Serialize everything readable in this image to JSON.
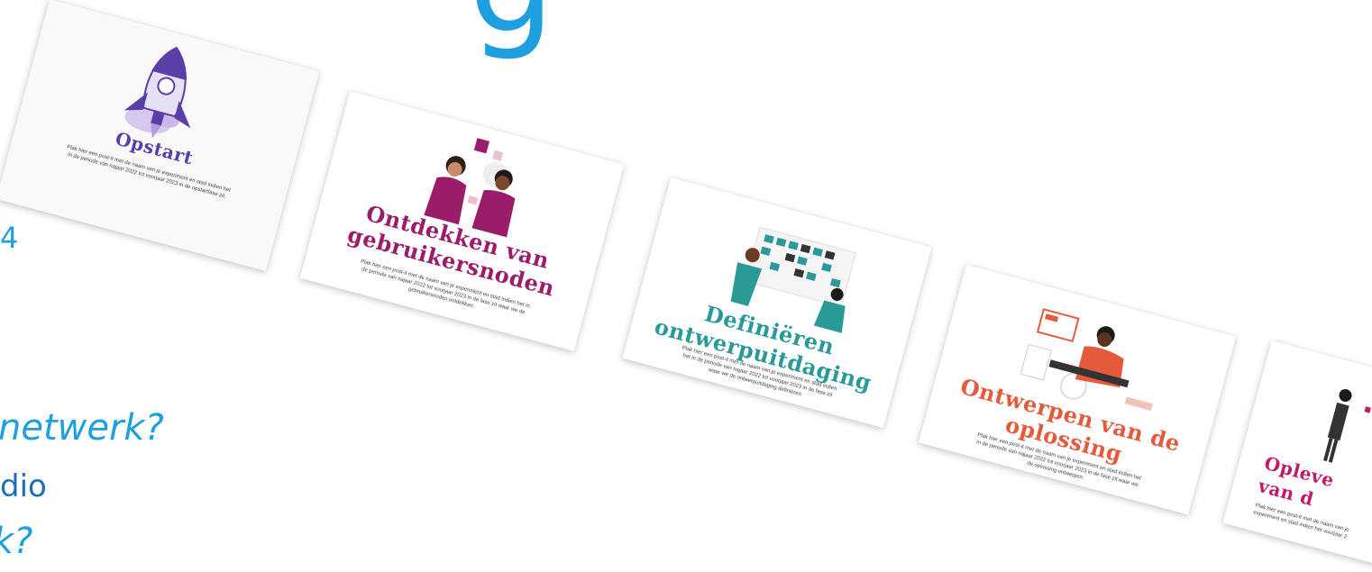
{
  "heading_fragment": "g",
  "left_fragments": {
    "line1": "4",
    "line2": "netwerk?",
    "line3": "dio",
    "line4": "k?"
  },
  "cards": [
    {
      "title": "Opstart",
      "body": "Plak hier een post-it met de naam van je experiment en stad indien het in de periode van najaar 2022 tot voorjaar 2023 in de opstartfase zit.",
      "color": "#5a3fa8",
      "icon": "rocket-icon"
    },
    {
      "title": "Ontdekken van gebruikersnoden",
      "body": "Plak hier een post-it met de naam van je experiment en stad indien het in de periode van najaar 2022 tot voorjaar 2023 in de fase zit waar we de gebruikersnoden ontdekken.",
      "color": "#9b1c6b",
      "icon": "two-people-icon"
    },
    {
      "title": "Definiëren ontwerpuitdaging",
      "body": "Plak hier een post-it met de naam van je experiment en stad indien het in de periode van najaar 2022 tot voorjaar 2023 in de fase zit waar we de ontwerpuitdaging definiëren.",
      "color": "#2a9a98",
      "icon": "planning-board-icon"
    },
    {
      "title": "Ontwerpen van de oplossing",
      "body": "Plak hier een post-it met de naam van je experiment en stad indien het in de periode van najaar 2022 tot voorjaar 2023 in de fase zit waar we de oplossing ontwerpen.",
      "color": "#e45a3a",
      "icon": "designer-icon"
    },
    {
      "title": "Opleve van d",
      "body": "Plak hier een post-it met de naam van je experiment en stad indien het voorjaar 2",
      "color": "#c21a6b",
      "icon": "person-icon"
    }
  ]
}
